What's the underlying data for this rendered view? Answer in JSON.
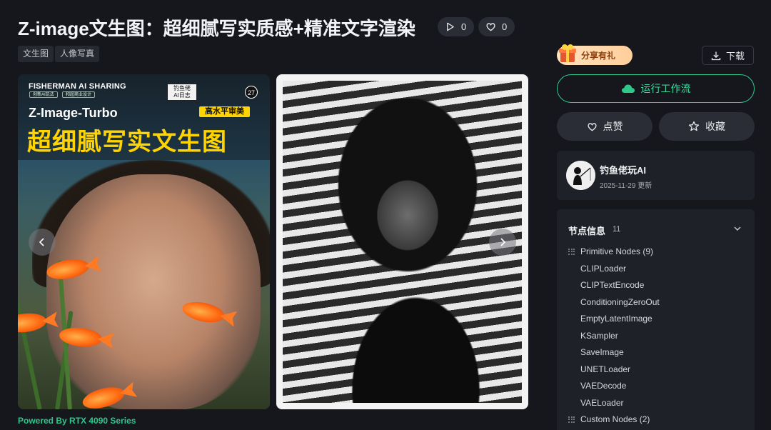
{
  "header": {
    "title": "Z-image文生图：超细腻写实质感+精准文字渲染",
    "run_count": "0",
    "like_count": "0"
  },
  "tags": [
    "文生图",
    "人像写真"
  ],
  "gallery": {
    "poster": {
      "brand": "FISHERMAN AI SHARING",
      "chip1": "创新AI玩法",
      "chip2": "和超商业设计",
      "sign": "钓鱼佬\nAI日志",
      "number": "27",
      "model": "Z-Image-Turbo",
      "badge": "高水平审美",
      "headline": "超细腻写实文生图"
    },
    "powered_by": "Powered By RTX 4090 Series"
  },
  "sidebar": {
    "share_label": "分享有礼",
    "download_label": "下载",
    "run_label": "运行工作流",
    "like_label": "点赞",
    "favorite_label": "收藏",
    "author": {
      "name": "钓鱼佬玩AI",
      "updated": "2025-11-29 更新"
    },
    "nodes": {
      "heading": "节点信息",
      "count": "11",
      "primitive_group": "Primitive Nodes (9)",
      "primitive_items": [
        "CLIPLoader",
        "CLIPTextEncode",
        "ConditioningZeroOut",
        "EmptyLatentImage",
        "KSampler",
        "SaveImage",
        "UNETLoader",
        "VAEDecode",
        "VAELoader"
      ],
      "custom_group": "Custom Nodes (2)"
    }
  },
  "colors": {
    "accent": "#2ec98a",
    "poster_yellow": "#ffd400",
    "background": "#15171d"
  }
}
